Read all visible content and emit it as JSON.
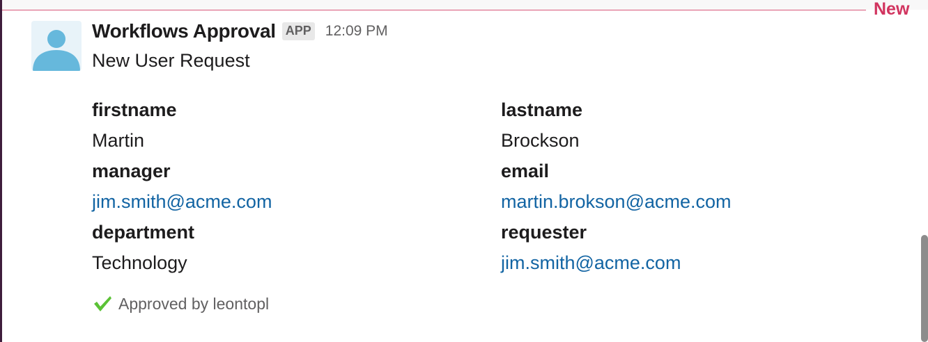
{
  "divider": {
    "label": "New"
  },
  "message": {
    "sender": "Workflows Approval",
    "badge": "APP",
    "time": "12:09 PM",
    "title": "New User Request"
  },
  "fields": {
    "firstname": {
      "label": "firstname",
      "value": "Martin"
    },
    "lastname": {
      "label": "lastname",
      "value": "Brockson"
    },
    "manager": {
      "label": "manager",
      "value": "jim.smith@acme.com"
    },
    "email": {
      "label": "email",
      "value": "martin.brokson@acme.com"
    },
    "department": {
      "label": "department",
      "value": "Technology"
    },
    "requester": {
      "label": "requester",
      "value": "jim.smith@acme.com"
    }
  },
  "approval": {
    "text": "Approved by leontopl"
  },
  "colors": {
    "new_divider": "#d1345f",
    "link": "#1264a3",
    "check": "#5bc236",
    "avatar": "#66b8dc"
  },
  "icons": {
    "avatar": "default-user-avatar",
    "approval": "checkmark-icon"
  }
}
